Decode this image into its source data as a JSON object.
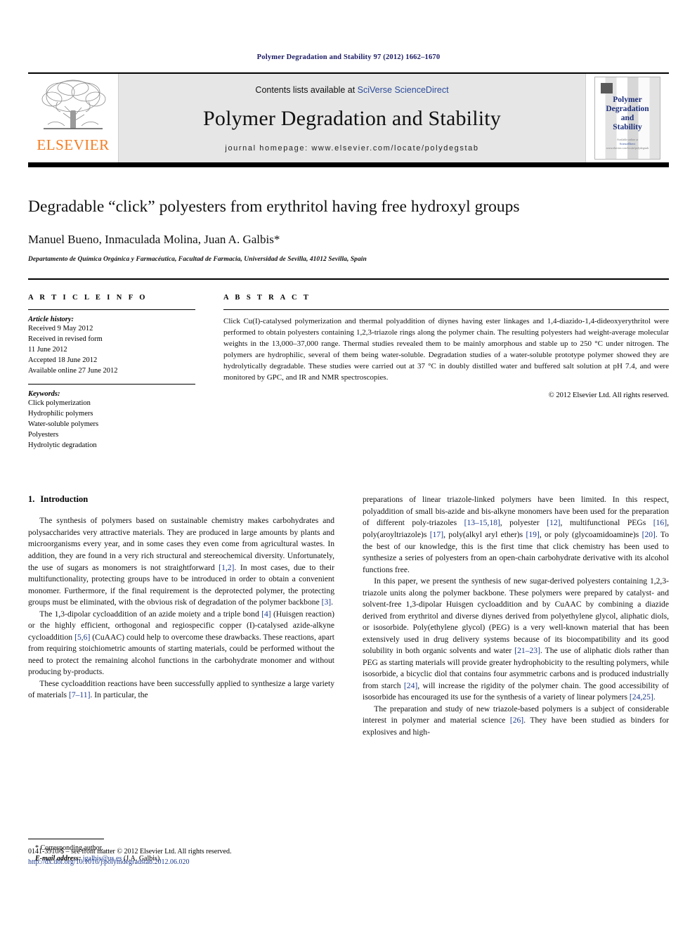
{
  "running_head": "Polymer Degradation and Stability 97 (2012) 1662–1670",
  "masthead": {
    "publisher_name": "ELSEVIER",
    "contents_prefix": "Contents lists available at ",
    "contents_link": "SciVerse ScienceDirect",
    "journal_title": "Polymer Degradation and Stability",
    "homepage": "journal homepage: www.elsevier.com/locate/polydegstab",
    "cover": {
      "line1": "Polymer",
      "line2": "Degradation",
      "line3": "and",
      "line4": "Stability",
      "foot1": "Available online at",
      "foot2": "ScienceDirect",
      "foot3": "www.elsevier.com/locate/polydegstab"
    }
  },
  "article": {
    "title": "Degradable “click” polyesters from erythritol having free hydroxyl groups",
    "authors": "Manuel Bueno, Inmaculada Molina, Juan A. Galbis*",
    "affiliation": "Departamento de Química Orgánica y Farmacéutica, Facultad de Farmacia, Universidad de Sevilla, 41012 Sevilla, Spain"
  },
  "info": {
    "label": "A R T I C L E   I N F O",
    "history_head": "Article history:",
    "history": [
      "Received 9 May 2012",
      "Received in revised form",
      "11 June 2012",
      "Accepted 18 June 2012",
      "Available online 27 June 2012"
    ],
    "keywords_head": "Keywords:",
    "keywords": [
      "Click polymerization",
      "Hydrophilic polymers",
      "Water-soluble polymers",
      "Polyesters",
      "Hydrolytic degradation"
    ]
  },
  "abstract": {
    "label": "A B S T R A C T",
    "text": "Click Cu(I)-catalysed polymerization and thermal polyaddition of diynes having ester linkages and 1,4-diazido-1,4-dideoxyerythritol were performed to obtain polyesters containing 1,2,3-triazole rings along the polymer chain. The resulting polyesters had weight-average molecular weights in the 13,000–37,000 range. Thermal studies revealed them to be mainly amorphous and stable up to 250 °C under nitrogen. The polymers are hydrophilic, several of them being water-soluble. Degradation studies of a water-soluble prototype polymer showed they are hydrolytically degradable. These studies were carried out at 37 °C in doubly distilled water and buffered salt solution at pH 7.4, and were monitored by GPC, and IR and NMR spectroscopies.",
    "copyright": "© 2012 Elsevier Ltd. All rights reserved."
  },
  "introduction": {
    "number": "1.",
    "heading": "Introduction",
    "left_paragraphs": [
      "The synthesis of polymers based on sustainable chemistry makes carbohydrates and polysaccharides very attractive materials. They are produced in large amounts by plants and microorganisms every year, and in some cases they even come from agricultural wastes. In addition, they are found in a very rich structural and stereochemical diversity. Unfortunately, the use of sugars as monomers is not straightforward [1,2]. In most cases, due to their multifunctionality, protecting groups have to be introduced in order to obtain a convenient monomer. Furthermore, if the final requirement is the deprotected polymer, the protecting groups must be eliminated, with the obvious risk of degradation of the polymer backbone [3].",
      "The 1,3-dipolar cycloaddition of an azide moiety and a triple bond [4] (Huisgen reaction) or the highly efficient, orthogonal and regiospecific copper (I)-catalysed azide-alkyne cycloaddition [5,6] (CuAAC) could help to overcome these drawbacks. These reactions, apart from requiring stoichiometric amounts of starting materials, could be performed without the need to protect the remaining alcohol functions in the carbohydrate monomer and without producing by-products.",
      "These cycloaddition reactions have been successfully applied to synthesize a large variety of materials [7–11]. In particular, the"
    ],
    "right_paragraphs": [
      "preparations of linear triazole-linked polymers have been limited. In this respect, polyaddition of small bis-azide and bis-alkyne monomers have been used for the preparation of different poly-triazoles [13–15,18], polyester [12], multifunctional PEGs [16], poly(aroyltriazole)s [17], poly(alkyl aryl ether)s [19], or poly (glycoamidoamine)s [20]. To the best of our knowledge, this is the first time that click chemistry has been used to synthesize a series of polyesters from an open-chain carbohydrate derivative with its alcohol functions free.",
      "In this paper, we present the synthesis of new sugar-derived polyesters containing 1,2,3-triazole units along the polymer backbone. These polymers were prepared by catalyst- and solvent-free 1,3-dipolar Huisgen cycloaddition and by CuAAC by combining a diazide derived from erythritol and diverse diynes derived from polyethylene glycol, aliphatic diols, or isosorbide. Poly(ethylene glycol) (PEG) is a very well-known material that has been extensively used in drug delivery systems because of its biocompatibility and its good solubility in both organic solvents and water [21–23]. The use of aliphatic diols rather than PEG as starting materials will provide greater hydrophobicity to the resulting polymers, while isosorbide, a bicyclic diol that contains four asymmetric carbons and is produced industrially from starch [24], will increase the rigidity of the polymer chain. The good accessibility of isosorbide has encouraged its use for the synthesis of a variety of linear polymers [24,25].",
      "The preparation and study of new triazole-based polymers is a subject of considerable interest in polymer and material science [26]. They have been studied as binders for explosives and high-"
    ]
  },
  "footnote": {
    "corresponding": "* Corresponding author.",
    "email_label": "E-mail address:",
    "email": "jgalbis@us.es",
    "email_owner": "(J.A. Galbis)."
  },
  "page_footer": {
    "front_matter": "0141-3910/$ – see front matter © 2012 Elsevier Ltd. All rights reserved.",
    "doi": "http://dx.doi.org/10.1016/j.polymdegradstab.2012.06.020"
  },
  "colors": {
    "link": "#1b3a8c",
    "elsevier_orange": "#f57c20",
    "band_gray": "#e6e6e6"
  }
}
